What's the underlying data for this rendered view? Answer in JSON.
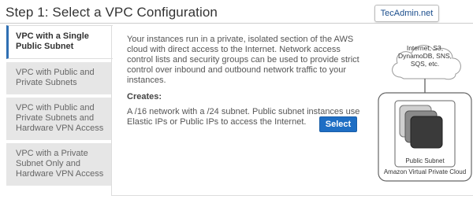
{
  "header": {
    "title": "Step 1: Select a VPC Configuration",
    "watermark": "TecAdmin.net"
  },
  "nav": {
    "items": [
      {
        "label": "VPC with a Single Public Subnet",
        "active": true
      },
      {
        "label": "VPC with Public and Private Subnets",
        "active": false
      },
      {
        "label": "VPC with Public and Private Subnets and Hardware VPN Access",
        "active": false
      },
      {
        "label": "VPC with a Private Subnet Only and Hardware VPN Access",
        "active": false
      }
    ]
  },
  "main": {
    "description": "Your instances run in a private, isolated section of the AWS cloud with direct access to the Internet. Network access control lists and security groups can be used to provide strict control over inbound and outbound network traffic to your instances.",
    "creates_label": "Creates:",
    "creates_text": "A /16 network with a /24 subnet. Public subnet instances use Elastic IPs or Public IPs to access the Internet.",
    "select_label": "Select"
  },
  "diagram": {
    "cloud_text": "Internet, S3, DynamoDB, SNS, SQS, etc.",
    "subnet_label": "Public Subnet",
    "vpc_label": "Amazon Virtual Private Cloud"
  }
}
